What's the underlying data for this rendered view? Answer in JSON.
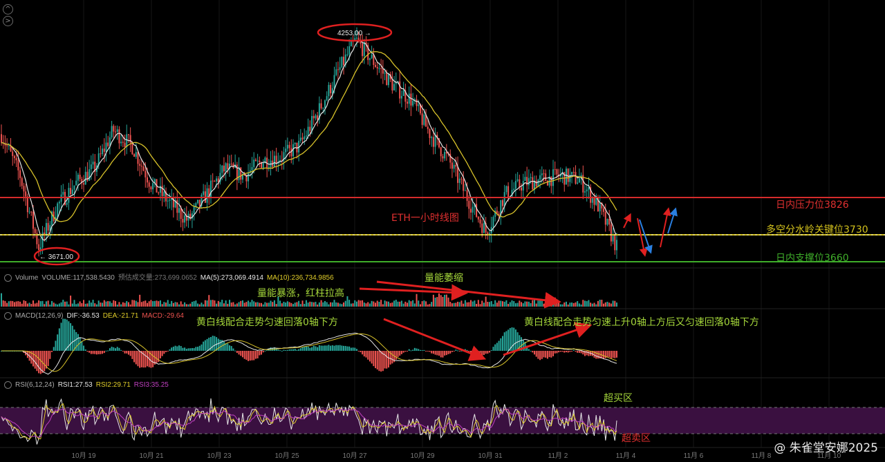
{
  "chart_data": {
    "type": "line",
    "title": "ETH一小时线图",
    "x_ticks": [
      "10月 19",
      "10月 21",
      "10月 23",
      "10月 25",
      "10月 27",
      "10月 29",
      "10月 31",
      "11月 2",
      "11月 4",
      "11月 6",
      "11月 8",
      "11月 10"
    ],
    "price_series": [
      {
        "date": "10月 18",
        "value": 3990
      },
      {
        "date": "10月 18 12h",
        "value": 3880
      },
      {
        "date": "10月 19",
        "value": 3690
      },
      {
        "date": "10月 19 12h",
        "value": 3800
      },
      {
        "date": "10月 20",
        "value": 3860
      },
      {
        "date": "10月 20 12h",
        "value": 3900
      },
      {
        "date": "10月 21",
        "value": 4000
      },
      {
        "date": "10月 21 12h",
        "value": 3960
      },
      {
        "date": "10月 22",
        "value": 3860
      },
      {
        "date": "10月 22 12h",
        "value": 3810
      },
      {
        "date": "10月 23",
        "value": 3760
      },
      {
        "date": "10月 23 12h",
        "value": 3830
      },
      {
        "date": "10月 24",
        "value": 3900
      },
      {
        "date": "10月 24 12h",
        "value": 3880
      },
      {
        "date": "10月 25",
        "value": 3920
      },
      {
        "date": "10月 25 12h",
        "value": 3930
      },
      {
        "date": "10月 26",
        "value": 3960
      },
      {
        "date": "10月 26 12h",
        "value": 4050
      },
      {
        "date": "10月 27",
        "value": 4150
      },
      {
        "date": "10月 27 12h",
        "value": 4240
      },
      {
        "date": "10月 28",
        "value": 4180
      },
      {
        "date": "10月 28 12h",
        "value": 4120
      },
      {
        "date": "10月 29",
        "value": 4080
      },
      {
        "date": "10月 29 12h",
        "value": 3990
      },
      {
        "date": "10月 30",
        "value": 3920
      },
      {
        "date": "10月 30 12h",
        "value": 3820
      },
      {
        "date": "10月 31",
        "value": 3730
      },
      {
        "date": "10月 31 12h",
        "value": 3830
      },
      {
        "date": "11月 1",
        "value": 3860
      },
      {
        "date": "11月 1 12h",
        "value": 3870
      },
      {
        "date": "11月 2",
        "value": 3880
      },
      {
        "date": "11月 2 12h",
        "value": 3870
      },
      {
        "date": "11月 3",
        "value": 3800
      },
      {
        "date": "11月 3 6h",
        "value": 3690
      }
    ],
    "peak_label": "4253.00 →",
    "low_label": "← 3671.00",
    "levels": [
      {
        "name": "日内压力位3826",
        "value": 3826,
        "color": "#d62b2b"
      },
      {
        "name": "多空分水岭关键位3730",
        "value": 3730,
        "color": "#d4c21c"
      },
      {
        "name": "日内支撑位3660",
        "value": 3660,
        "color": "#3fae2a"
      }
    ],
    "y_range": [
      3650,
      4300
    ],
    "projection_arrows": [
      "red-down",
      "blue-down",
      "red-up",
      "blue-up"
    ]
  },
  "panels": {
    "volume": {
      "label": "Volume",
      "volume": "VOLUME:117,538.5430",
      "est": "预估成交量:273,699.0652",
      "ma5": "MA(5):273,069.4914",
      "ma10": "MA(10):236,734.9856"
    },
    "macd": {
      "label": "MACD(12,26,9)",
      "dif": "DIF:-36.53",
      "dea": "DEA:-21.71",
      "macd": "MACD:-29.64"
    },
    "rsi": {
      "label": "RSI(6,12,24)",
      "rsi1": "RSI1:27.53",
      "rsi2": "RSI2:29.71",
      "rsi3": "RSI3:35.25"
    }
  },
  "annotations": {
    "volume_surge": "量能暴涨，红柱拉高",
    "volume_shrink": "量能萎缩",
    "macd_left": "黄白线配合走势匀速回落0轴下方",
    "macd_right": "黄白线配合走势匀速上升0轴上方后又匀速回落0轴下方",
    "overbought": "超买区",
    "oversold": "超卖区"
  },
  "watermark": "@ 朱雀堂安娜2025",
  "colors": {
    "up": "#26a69a",
    "down": "#ef5350",
    "ma_white": "#e0e0e0",
    "ma_yellow": "#d8c22a",
    "rsi_band": "#3a1040"
  }
}
